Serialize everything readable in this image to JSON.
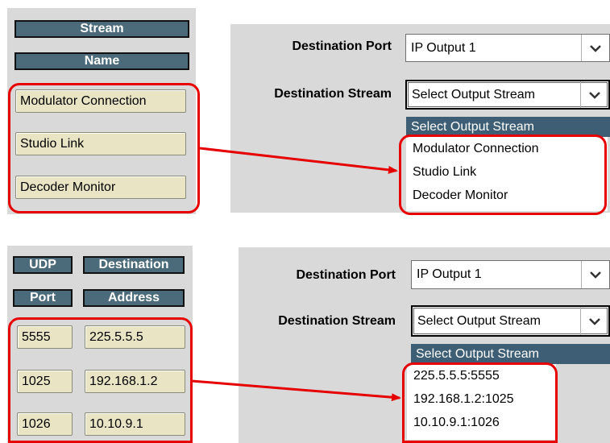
{
  "top": {
    "left": {
      "headers": [
        "Stream",
        "Name"
      ],
      "fields": [
        "Modulator Connection",
        "Studio Link",
        "Decoder Monitor"
      ]
    },
    "right": {
      "dest_port_label": "Destination Port",
      "dest_port_value": "IP Output 1",
      "dest_stream_label": "Destination Stream",
      "dest_stream_value": "Select Output Stream",
      "dropdown_header": "Select Output Stream",
      "dropdown_items": [
        "Modulator Connection",
        "Studio Link",
        "Decoder Monitor"
      ]
    }
  },
  "bottom": {
    "left": {
      "headers": {
        "udp_line1": "UDP",
        "udp_line2": "Port",
        "dest_line1": "Destination",
        "dest_line2": "Address"
      },
      "rows": [
        {
          "port": "5555",
          "address": "225.5.5.5"
        },
        {
          "port": "1025",
          "address": "192.168.1.2"
        },
        {
          "port": "1026",
          "address": "10.10.9.1"
        }
      ]
    },
    "right": {
      "dest_port_label": "Destination Port",
      "dest_port_value": "IP Output 1",
      "dest_stream_label": "Destination Stream",
      "dest_stream_value": "Select Output Stream",
      "dropdown_header": "Select Output Stream",
      "dropdown_items": [
        "225.5.5.5:5555",
        "192.168.1.2:1025",
        "10.10.9.1:1026"
      ]
    }
  },
  "colors": {
    "highlight": "#e60000",
    "header_bg": "#4b6b7a",
    "field_bg": "#e8e4c4"
  }
}
